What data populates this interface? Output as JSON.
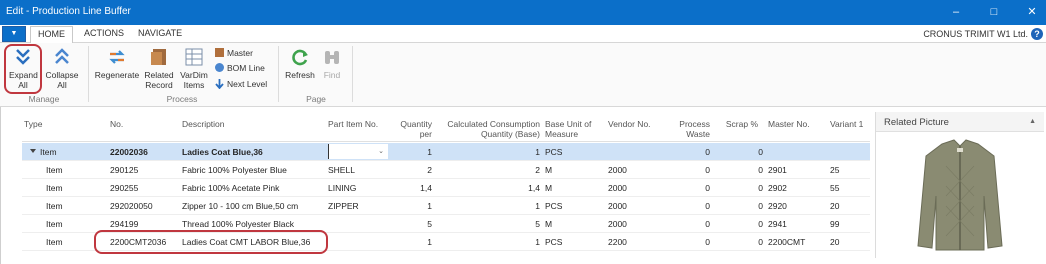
{
  "window": {
    "title": "Edit - Production Line Buffer"
  },
  "tabs": [
    {
      "label": "HOME",
      "active": true
    },
    {
      "label": "ACTIONS",
      "active": false
    },
    {
      "label": "NAVIGATE",
      "active": false
    }
  ],
  "company": "CRONUS TRIMIT W1 Ltd.",
  "ribbon": {
    "expand_all": "Expand All",
    "collapse_all": "Collapse All",
    "regenerate": "Regenerate",
    "related_record": "Related Record",
    "vardim_items": "VarDim Items",
    "master": "Master",
    "bom_line": "BOM Line",
    "next_level": "Next Level",
    "refresh": "Refresh",
    "find": "Find",
    "groups": {
      "manage": "Manage",
      "process": "Process",
      "page": "Page"
    }
  },
  "grid": {
    "columns": [
      "Type",
      "No.",
      "Description",
      "Part Item No.",
      "Quantity per",
      "Calculated Consumption Quantity (Base)",
      "Base Unit of Measure",
      "Vendor No.",
      "Process Waste",
      "Scrap %",
      "Master No.",
      "Variant 1"
    ],
    "rows": [
      {
        "type": "Item",
        "no": "22002036",
        "description": "Ladies Coat Blue,36",
        "part_item_no": "",
        "quantity_per": "1",
        "calc_consumption": "1",
        "base_uom": "PCS",
        "vendor_no": "",
        "process_waste": "0",
        "scrap": "0",
        "master_no": "",
        "variant1": ""
      },
      {
        "type": "Item",
        "no": "290125",
        "description": "Fabric 100% Polyester Blue",
        "part_item_no": "SHELL",
        "quantity_per": "2",
        "calc_consumption": "2",
        "base_uom": "M",
        "vendor_no": "2000",
        "process_waste": "0",
        "scrap": "0",
        "master_no": "2901",
        "variant1": "25"
      },
      {
        "type": "Item",
        "no": "290255",
        "description": "Fabric 100% Acetate Pink",
        "part_item_no": "LINING",
        "quantity_per": "1,4",
        "calc_consumption": "1,4",
        "base_uom": "M",
        "vendor_no": "2000",
        "process_waste": "0",
        "scrap": "0",
        "master_no": "2902",
        "variant1": "55"
      },
      {
        "type": "Item",
        "no": "292020050",
        "description": "Zipper 10 - 100 cm Blue,50 cm",
        "part_item_no": "ZIPPER",
        "quantity_per": "1",
        "calc_consumption": "1",
        "base_uom": "PCS",
        "vendor_no": "2000",
        "process_waste": "0",
        "scrap": "0",
        "master_no": "2920",
        "variant1": "20"
      },
      {
        "type": "Item",
        "no": "294199",
        "description": "Thread 100% Polyester Black",
        "part_item_no": "",
        "quantity_per": "5",
        "calc_consumption": "5",
        "base_uom": "M",
        "vendor_no": "2000",
        "process_waste": "0",
        "scrap": "0",
        "master_no": "2941",
        "variant1": "99"
      },
      {
        "type": "Item",
        "no": "2200CMT2036",
        "description": "Ladies Coat CMT LABOR Blue,36",
        "part_item_no": "",
        "quantity_per": "1",
        "calc_consumption": "1",
        "base_uom": "PCS",
        "vendor_no": "2200",
        "process_waste": "0",
        "scrap": "0",
        "master_no": "2200CMT",
        "variant1": "20"
      }
    ]
  },
  "related_picture": {
    "title": "Related Picture"
  },
  "colors": {
    "accent": "#0b6fc9",
    "selected_row": "#cfe2f7",
    "callout": "#c0373f"
  }
}
